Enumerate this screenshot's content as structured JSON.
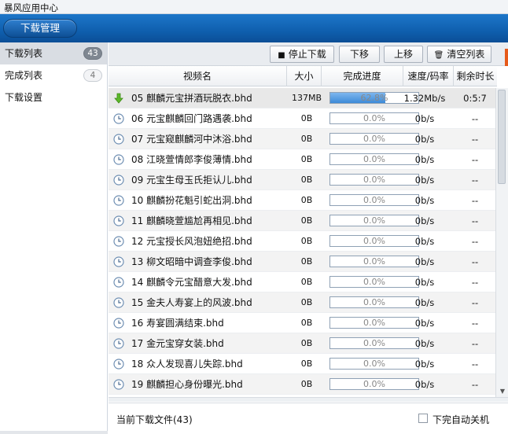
{
  "window": {
    "title": "暴风应用中心"
  },
  "top_tab": {
    "label": "下载管理"
  },
  "sidebar": {
    "items": [
      {
        "label": "下载列表",
        "count": "43",
        "active": true
      },
      {
        "label": "完成列表",
        "count": "4",
        "active": false
      },
      {
        "label": "下载设置",
        "count": "",
        "active": false
      }
    ]
  },
  "toolbar": {
    "stop_label": "停止下载",
    "down_label": "下移",
    "up_label": "上移",
    "clear_label": "清空列表"
  },
  "table": {
    "headers": {
      "name": "视频名",
      "size": "大小",
      "progress": "完成进度",
      "speed": "速度/码率",
      "remaining": "剩余时长"
    },
    "rows": [
      {
        "status": "downloading",
        "name": "05 麒麟元宝拼酒玩脱衣.bhd",
        "size": "137MB",
        "progress": 0.628,
        "progress_text": "62.8%",
        "speed": "1.32Mb/s",
        "remaining": "0:5:7"
      },
      {
        "status": "waiting",
        "name": "06 元宝麒麟回门路遇袭.bhd",
        "size": "0B",
        "progress": 0,
        "progress_text": "0.0%",
        "speed": "0b/s",
        "remaining": "--"
      },
      {
        "status": "waiting",
        "name": "07 元宝窥麒麟河中沐浴.bhd",
        "size": "0B",
        "progress": 0,
        "progress_text": "0.0%",
        "speed": "0b/s",
        "remaining": "--"
      },
      {
        "status": "waiting",
        "name": "08 江晓萱情郎李俊薄情.bhd",
        "size": "0B",
        "progress": 0,
        "progress_text": "0.0%",
        "speed": "0b/s",
        "remaining": "--"
      },
      {
        "status": "waiting",
        "name": "09 元宝生母玉氏拒认儿.bhd",
        "size": "0B",
        "progress": 0,
        "progress_text": "0.0%",
        "speed": "0b/s",
        "remaining": "--"
      },
      {
        "status": "waiting",
        "name": "10 麒麟扮花魁引蛇出洞.bhd",
        "size": "0B",
        "progress": 0,
        "progress_text": "0.0%",
        "speed": "0b/s",
        "remaining": "--"
      },
      {
        "status": "waiting",
        "name": "11 麒麟晓萱尴尬再相见.bhd",
        "size": "0B",
        "progress": 0,
        "progress_text": "0.0%",
        "speed": "0b/s",
        "remaining": "--"
      },
      {
        "status": "waiting",
        "name": "12 元宝授长风泡妞绝招.bhd",
        "size": "0B",
        "progress": 0,
        "progress_text": "0.0%",
        "speed": "0b/s",
        "remaining": "--"
      },
      {
        "status": "waiting",
        "name": "13 柳文昭暗中调查李俊.bhd",
        "size": "0B",
        "progress": 0,
        "progress_text": "0.0%",
        "speed": "0b/s",
        "remaining": "--"
      },
      {
        "status": "waiting",
        "name": "14 麒麟令元宝醋意大发.bhd",
        "size": "0B",
        "progress": 0,
        "progress_text": "0.0%",
        "speed": "0b/s",
        "remaining": "--"
      },
      {
        "status": "waiting",
        "name": "15 金夫人寿宴上的风波.bhd",
        "size": "0B",
        "progress": 0,
        "progress_text": "0.0%",
        "speed": "0b/s",
        "remaining": "--"
      },
      {
        "status": "waiting",
        "name": "16 寿宴圆满结束.bhd",
        "size": "0B",
        "progress": 0,
        "progress_text": "0.0%",
        "speed": "0b/s",
        "remaining": "--"
      },
      {
        "status": "waiting",
        "name": "17 金元宝穿女装.bhd",
        "size": "0B",
        "progress": 0,
        "progress_text": "0.0%",
        "speed": "0b/s",
        "remaining": "--"
      },
      {
        "status": "waiting",
        "name": "18 众人发现喜儿失踪.bhd",
        "size": "0B",
        "progress": 0,
        "progress_text": "0.0%",
        "speed": "0b/s",
        "remaining": "--"
      },
      {
        "status": "waiting",
        "name": "19 麒麟担心身份曝光.bhd",
        "size": "0B",
        "progress": 0,
        "progress_text": "0.0%",
        "speed": "0b/s",
        "remaining": "--"
      }
    ]
  },
  "status_bar": {
    "current_files": "当前下载文件(43)",
    "shutdown_label": "下完自动关机",
    "shutdown_checked": false
  },
  "colors": {
    "accent": "#0f5fae",
    "progress_fill": "#3d8ad8",
    "downloading_icon": "#4aa61e"
  }
}
